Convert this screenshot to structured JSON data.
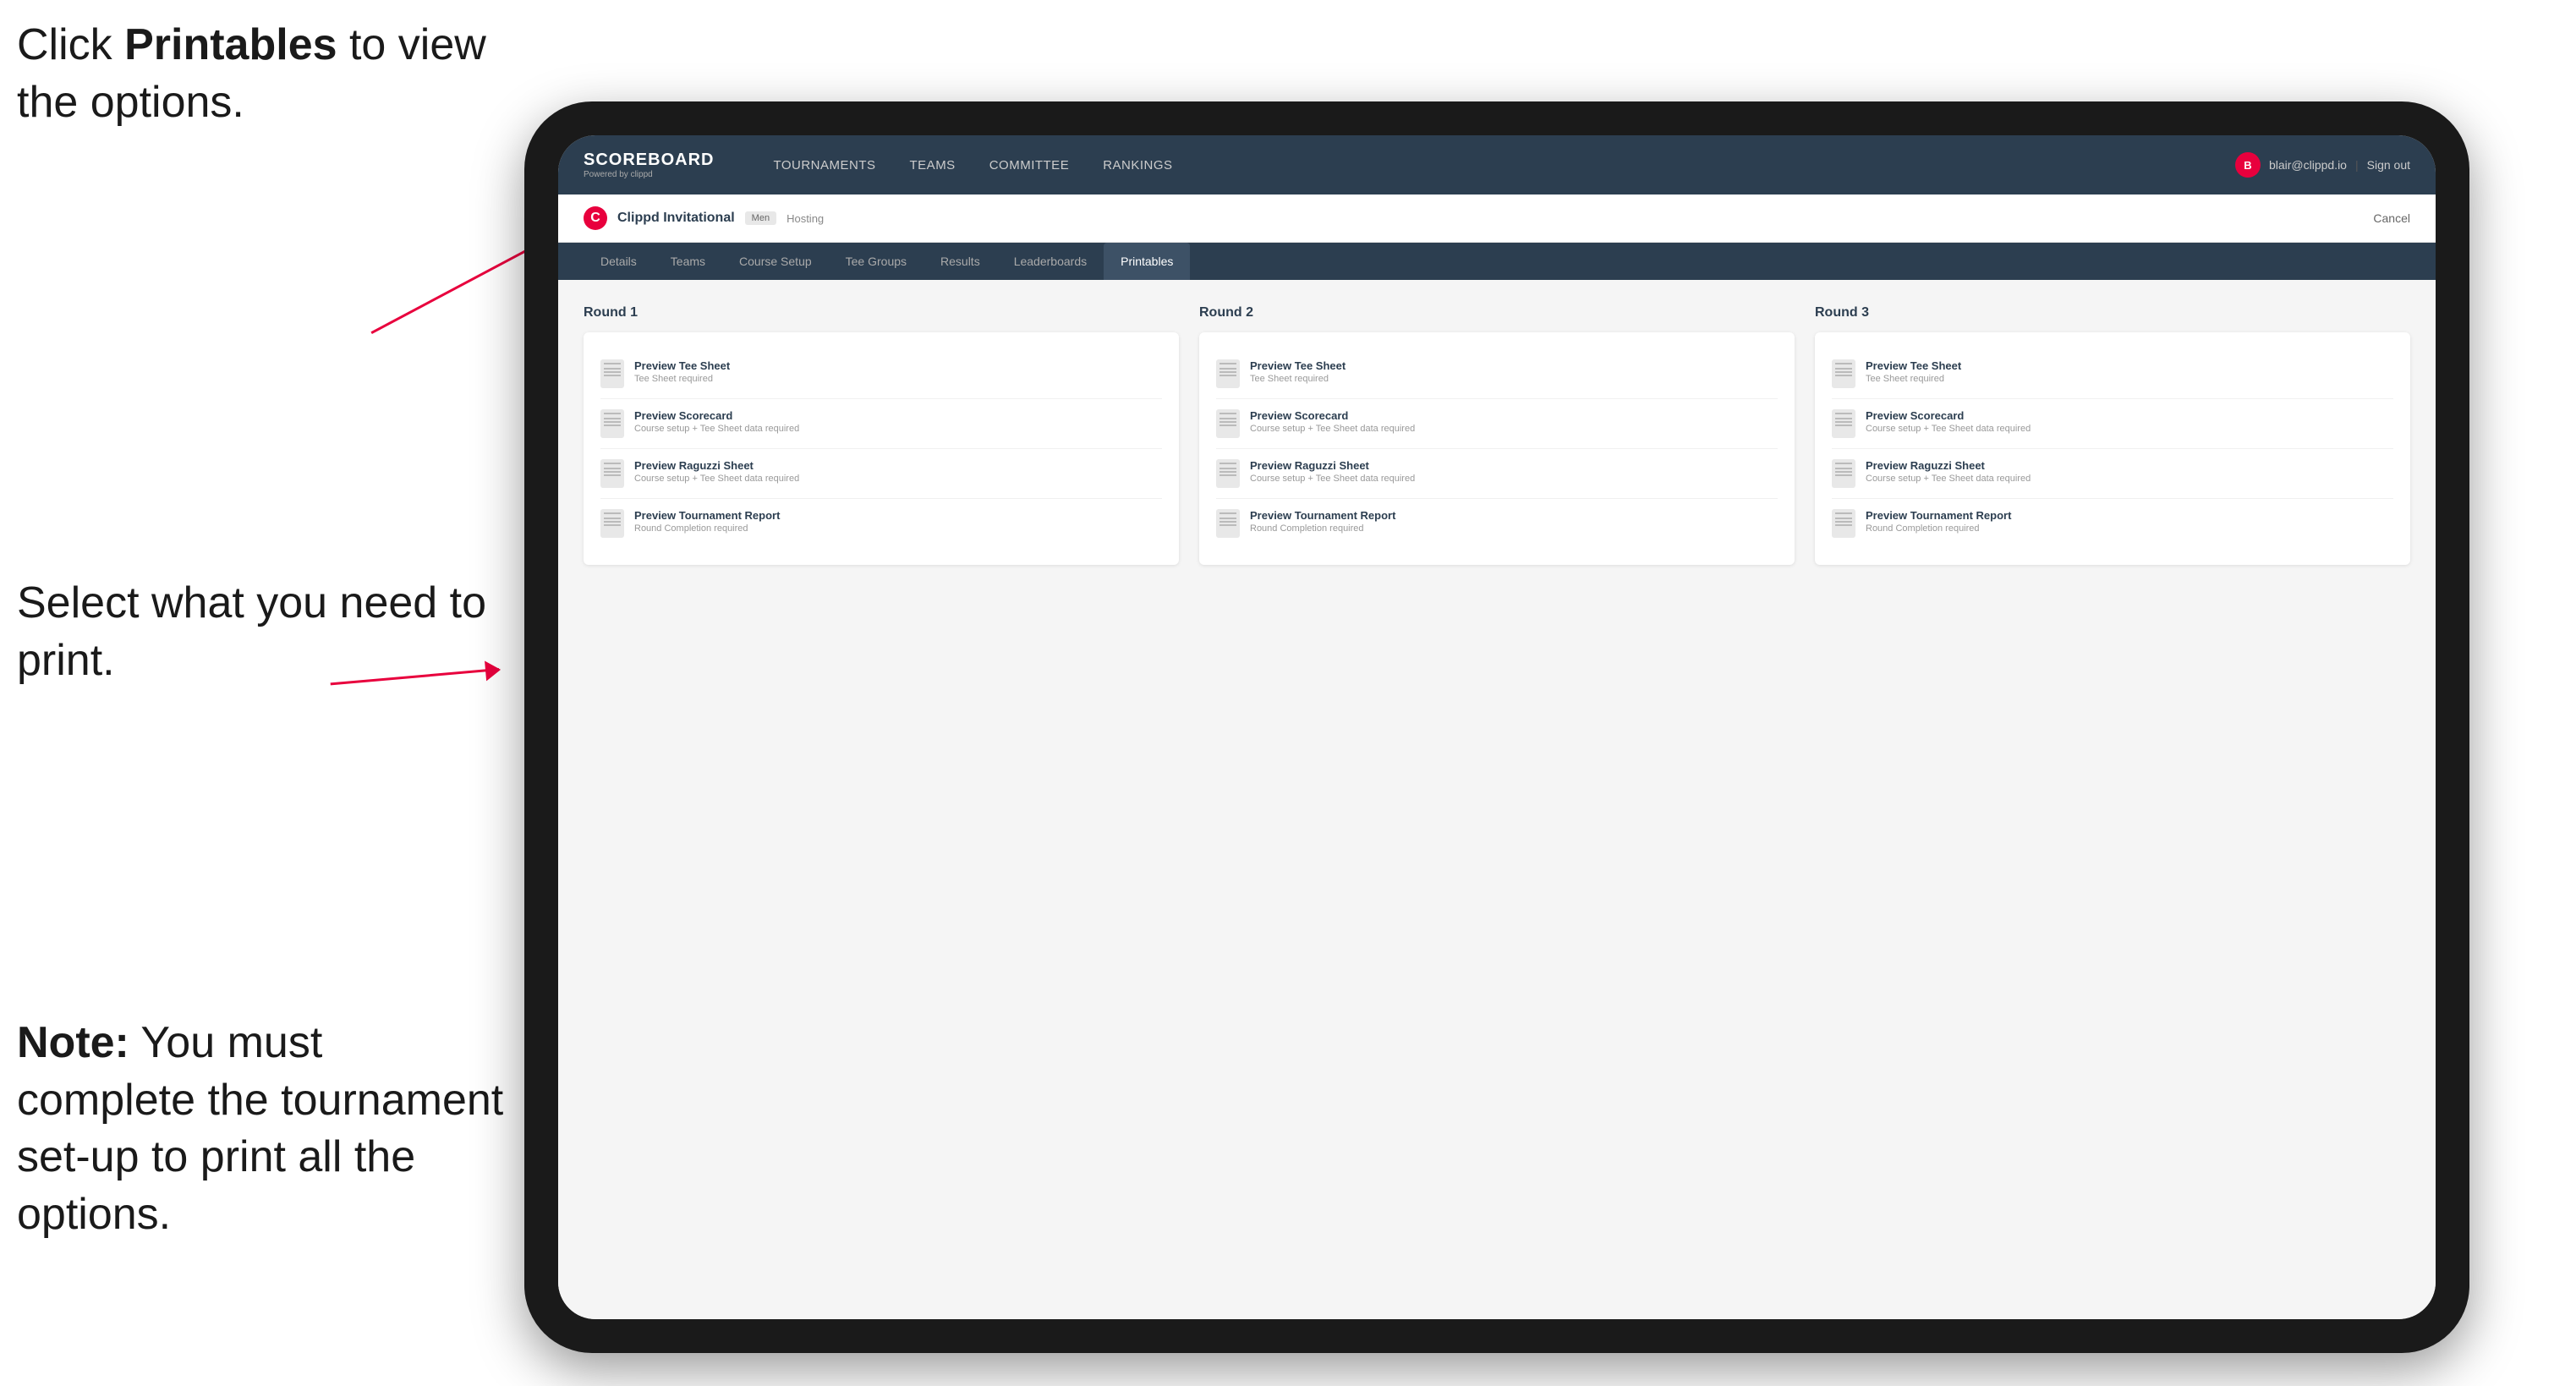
{
  "annotations": {
    "top": {
      "prefix": "Click ",
      "bold": "Printables",
      "suffix": " to view the options."
    },
    "middle": "Select what you need to print.",
    "bottom": {
      "bold": "Note:",
      "suffix": " You must complete the tournament set-up to print all the options."
    }
  },
  "nav": {
    "logo_title": "SCOREBOARD",
    "logo_subtitle": "Powered by clippd",
    "links": [
      {
        "label": "TOURNAMENTS",
        "active": false
      },
      {
        "label": "TEAMS",
        "active": false
      },
      {
        "label": "COMMITTEE",
        "active": false
      },
      {
        "label": "RANKINGS",
        "active": false
      }
    ],
    "user_email": "blair@clippd.io",
    "sign_out": "Sign out",
    "user_initial": "B"
  },
  "tournament": {
    "name": "Clippd Invitational",
    "badge": "Men",
    "hosting": "Hosting",
    "cancel": "Cancel"
  },
  "tabs": [
    {
      "label": "Details",
      "active": false
    },
    {
      "label": "Teams",
      "active": false
    },
    {
      "label": "Course Setup",
      "active": false
    },
    {
      "label": "Tee Groups",
      "active": false
    },
    {
      "label": "Results",
      "active": false
    },
    {
      "label": "Leaderboards",
      "active": false
    },
    {
      "label": "Printables",
      "active": true
    }
  ],
  "rounds": [
    {
      "title": "Round 1",
      "items": [
        {
          "name": "Preview Tee Sheet",
          "requirement": "Tee Sheet required"
        },
        {
          "name": "Preview Scorecard",
          "requirement": "Course setup + Tee Sheet data required"
        },
        {
          "name": "Preview Raguzzi Sheet",
          "requirement": "Course setup + Tee Sheet data required"
        },
        {
          "name": "Preview Tournament Report",
          "requirement": "Round Completion required"
        }
      ]
    },
    {
      "title": "Round 2",
      "items": [
        {
          "name": "Preview Tee Sheet",
          "requirement": "Tee Sheet required"
        },
        {
          "name": "Preview Scorecard",
          "requirement": "Course setup + Tee Sheet data required"
        },
        {
          "name": "Preview Raguzzi Sheet",
          "requirement": "Course setup + Tee Sheet data required"
        },
        {
          "name": "Preview Tournament Report",
          "requirement": "Round Completion required"
        }
      ]
    },
    {
      "title": "Round 3",
      "items": [
        {
          "name": "Preview Tee Sheet",
          "requirement": "Tee Sheet required"
        },
        {
          "name": "Preview Scorecard",
          "requirement": "Course setup + Tee Sheet data required"
        },
        {
          "name": "Preview Raguzzi Sheet",
          "requirement": "Course setup + Tee Sheet data required"
        },
        {
          "name": "Preview Tournament Report",
          "requirement": "Round Completion required"
        }
      ]
    }
  ]
}
